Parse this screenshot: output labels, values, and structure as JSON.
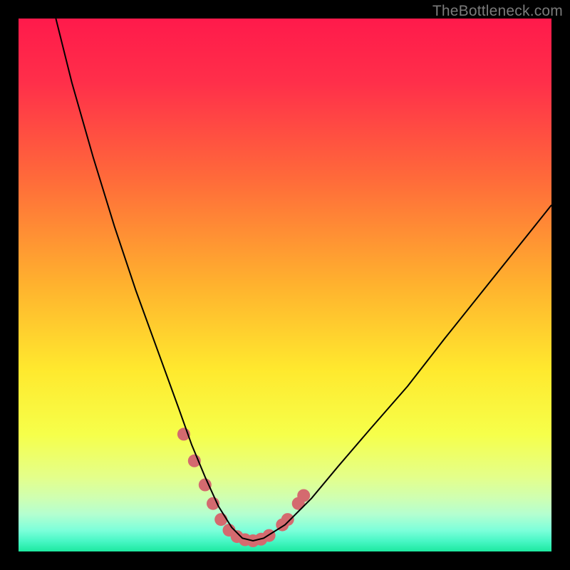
{
  "watermark": {
    "text": "TheBottleneck.com"
  },
  "palette": {
    "black_frame": "#000000",
    "curve_stroke": "#000000",
    "marker_fill": "#d46a6f",
    "gradient_stops": [
      {
        "offset": "0%",
        "color": "#ff1a4b"
      },
      {
        "offset": "12%",
        "color": "#ff2f4a"
      },
      {
        "offset": "30%",
        "color": "#ff6a3a"
      },
      {
        "offset": "50%",
        "color": "#ffb22e"
      },
      {
        "offset": "66%",
        "color": "#ffe92e"
      },
      {
        "offset": "78%",
        "color": "#f6ff4a"
      },
      {
        "offset": "86%",
        "color": "#e4ff8a"
      },
      {
        "offset": "90%",
        "color": "#cfffb2"
      },
      {
        "offset": "93%",
        "color": "#b4ffd0"
      },
      {
        "offset": "96%",
        "color": "#7dffda"
      },
      {
        "offset": "98%",
        "color": "#49f7c6"
      },
      {
        "offset": "100%",
        "color": "#1de9a0"
      }
    ]
  },
  "chart_data": {
    "type": "line",
    "title": "",
    "xlabel": "",
    "ylabel": "",
    "xlim": [
      0,
      100
    ],
    "ylim": [
      0,
      100
    ],
    "grid": false,
    "notes": "V-shaped bottleneck curve. Values are percent-relative estimates read from pixel geometry (no axes/ticks present).",
    "series": [
      {
        "name": "bottleneck-curve",
        "x": [
          7,
          10,
          14,
          18,
          22,
          26,
          30,
          32.5,
          35,
          37.5,
          40,
          42,
          44,
          46,
          50,
          55,
          60,
          66,
          73,
          80,
          88,
          96,
          100
        ],
        "y": [
          100,
          88,
          74,
          61,
          49,
          38,
          27,
          20,
          14,
          8.5,
          4.5,
          2.5,
          2,
          2.5,
          5,
          10,
          16,
          23,
          31,
          40,
          50,
          60,
          65
        ]
      }
    ],
    "markers": {
      "name": "highlight-dots",
      "color_ref": "marker_fill",
      "points": [
        {
          "x": 31.0,
          "y": 22.0
        },
        {
          "x": 33.0,
          "y": 17.0
        },
        {
          "x": 35.0,
          "y": 12.5
        },
        {
          "x": 36.5,
          "y": 9.0
        },
        {
          "x": 38.0,
          "y": 6.0
        },
        {
          "x": 39.5,
          "y": 4.0
        },
        {
          "x": 41.0,
          "y": 2.8
        },
        {
          "x": 42.5,
          "y": 2.2
        },
        {
          "x": 44.0,
          "y": 2.0
        },
        {
          "x": 45.5,
          "y": 2.3
        },
        {
          "x": 47.0,
          "y": 3.0
        },
        {
          "x": 49.5,
          "y": 5.0
        },
        {
          "x": 50.5,
          "y": 6.0
        },
        {
          "x": 52.5,
          "y": 9.0
        },
        {
          "x": 53.5,
          "y": 10.5
        }
      ]
    }
  }
}
